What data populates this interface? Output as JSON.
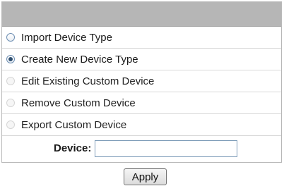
{
  "options": [
    {
      "label": "Import Device Type",
      "checked": false,
      "disabled": false
    },
    {
      "label": "Create New Device Type",
      "checked": true,
      "disabled": false
    },
    {
      "label": "Edit Existing Custom Device",
      "checked": false,
      "disabled": true
    },
    {
      "label": "Remove Custom Device",
      "checked": false,
      "disabled": true
    },
    {
      "label": "Export Custom Device",
      "checked": false,
      "disabled": true
    }
  ],
  "device": {
    "label": "Device:",
    "value": ""
  },
  "apply_label": "Apply"
}
